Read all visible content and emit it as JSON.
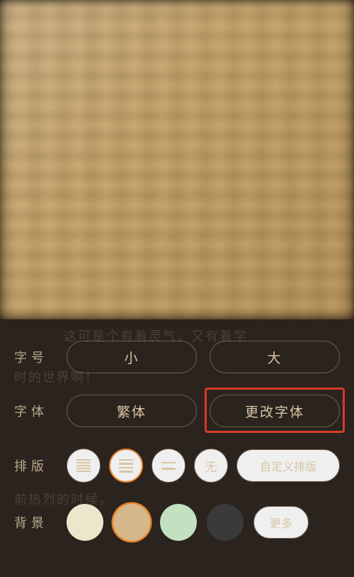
{
  "reading_area": {
    "blurred": true
  },
  "panel": {
    "font_size": {
      "label": "字号",
      "decrease": "小",
      "increase": "大"
    },
    "font_face": {
      "label": "字体",
      "traditional": "繁体",
      "change_font": "更改字体"
    },
    "layout": {
      "label": "排版",
      "options": {
        "tight": "tight-lines",
        "normal": "normal-lines",
        "loose": "loose-lines",
        "none": "无",
        "custom": "自定义排版"
      },
      "selected": "normal"
    },
    "background": {
      "label": "背景",
      "colors": [
        {
          "name": "cream",
          "hex": "#ece6cc"
        },
        {
          "name": "tan",
          "hex": "#d4b88a"
        },
        {
          "name": "green",
          "hex": "#c3e0c0"
        },
        {
          "name": "dark",
          "hex": "#3a3a3a"
        }
      ],
      "selected": "tan",
      "more": "更多"
    }
  },
  "highlight": {
    "target": "change-font-button"
  },
  "colors": {
    "accent": "#e8822c",
    "panel_bg": "#2a231e",
    "border": "#6b5d4c",
    "text": "#d7c5a4",
    "highlight_box": "#d63b2a"
  }
}
